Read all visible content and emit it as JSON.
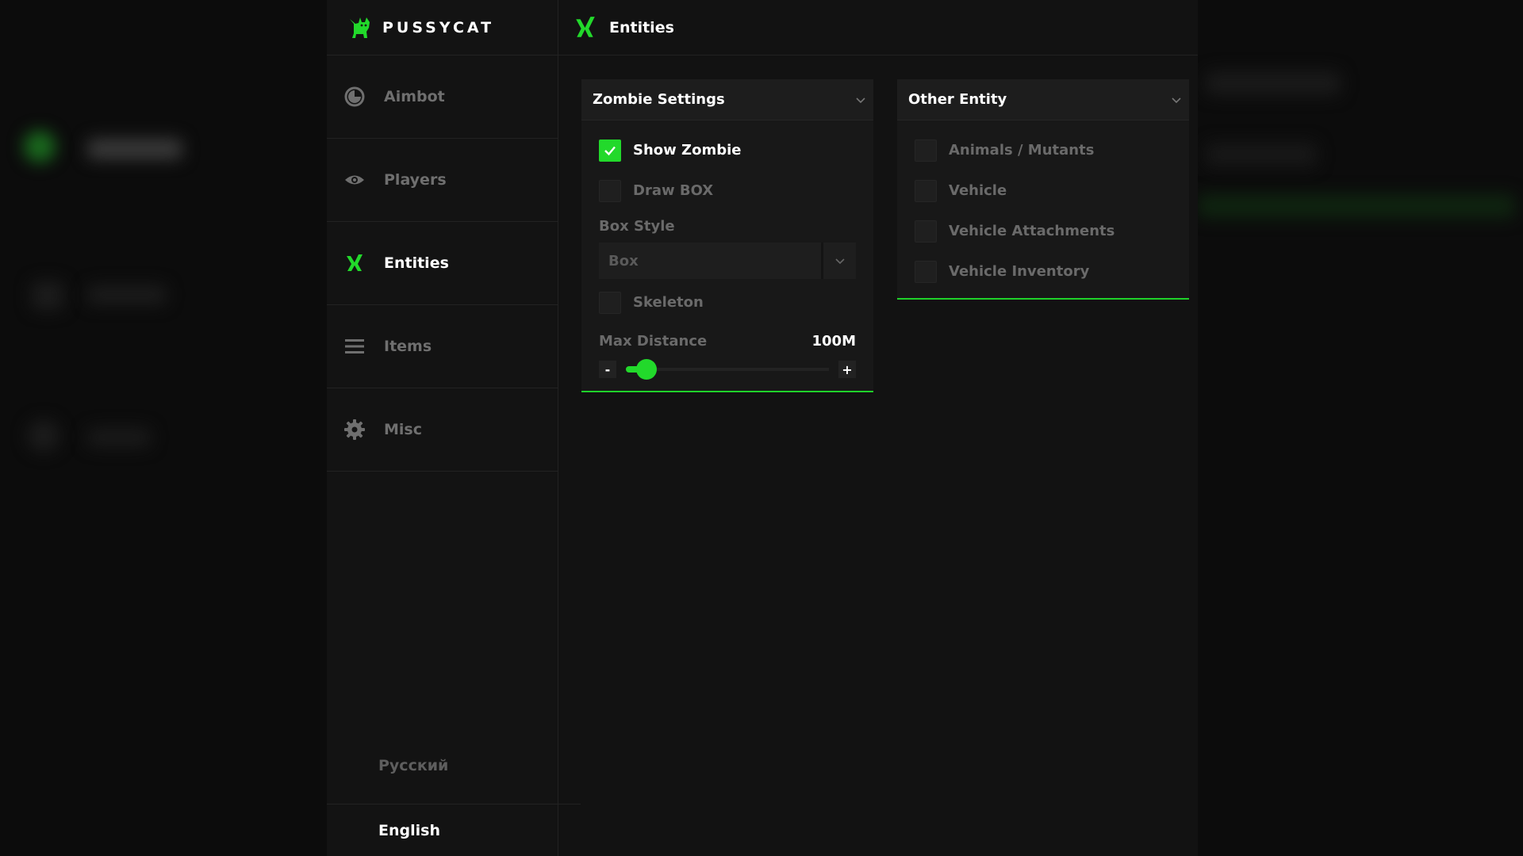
{
  "brand": {
    "name": "PUSSYCAT"
  },
  "sidebar": {
    "items": [
      {
        "label": "Aimbot",
        "icon": "aimbot-icon",
        "active": false
      },
      {
        "label": "Players",
        "icon": "eye-icon",
        "active": false
      },
      {
        "label": "Entities",
        "icon": "entities-icon",
        "active": true
      },
      {
        "label": "Items",
        "icon": "menu-lines-icon",
        "active": false
      },
      {
        "label": "Misc",
        "icon": "gear-icon",
        "active": false
      }
    ],
    "languages": [
      "Русский",
      "English"
    ],
    "selected_language": "English"
  },
  "header": {
    "title": "Entities"
  },
  "zombie_panel": {
    "title": "Zombie Settings",
    "show_zombie": {
      "label": "Show Zombie",
      "checked": true
    },
    "draw_box": {
      "label": "Draw BOX",
      "checked": false
    },
    "box_style_label": "Box Style",
    "box_style_value": "Box",
    "skeleton": {
      "label": "Skeleton",
      "checked": false
    },
    "max_distance_label": "Max Distance",
    "max_distance_value": "100M",
    "max_distance_fraction": 0.1,
    "minus": "-",
    "plus": "+"
  },
  "other_panel": {
    "title": "Other Entity",
    "items": [
      {
        "label": "Animals / Mutants",
        "checked": false
      },
      {
        "label": "Vehicle",
        "checked": false
      },
      {
        "label": "Vehicle Attachments",
        "checked": false
      },
      {
        "label": "Vehicle Inventory",
        "checked": false
      }
    ]
  },
  "colors": {
    "accent": "#22d92b",
    "background": "#121212",
    "text_muted": "#6a6a6a"
  }
}
